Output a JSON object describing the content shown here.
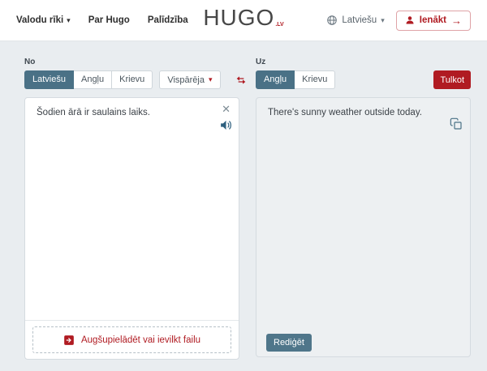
{
  "header": {
    "nav_items": [
      {
        "label": "Valodu rīki"
      },
      {
        "label": "Par Hugo"
      },
      {
        "label": "Palīdzība"
      }
    ],
    "logo": {
      "text": "HUGO",
      "suffix": ".LV"
    },
    "language_selector": {
      "label": "Latviešu"
    },
    "login_button": {
      "label": "Ienākt"
    }
  },
  "translator": {
    "source": {
      "label": "No",
      "language_tabs": [
        "Latviešu",
        "Angļu",
        "Krievu"
      ],
      "selected_language": "Latviešu",
      "domain_selector": "Vispārēja",
      "text": "Šodien ārā ir saulains laiks.",
      "upload_label": "Augšupielādēt vai ievilkt failu"
    },
    "target": {
      "label": "Uz",
      "language_tabs": [
        "Angļu",
        "Krievu"
      ],
      "selected_language": "Angļu",
      "translate_button": "Tulkot",
      "text": "There's sunny weather outside today.",
      "edit_button": "Rediģēt"
    }
  },
  "icons": {
    "nav_caret": "▾",
    "language_caret": "▾",
    "domain_caret": "▾",
    "login_arrow": "→",
    "close": "✕",
    "globe": "globe-icon",
    "person": "person-icon",
    "swap": "swap-languages-icon",
    "speaker": "text-to-speech-icon",
    "copy": "copy-icon",
    "upload": "upload-file-icon"
  },
  "colors": {
    "accent_red": "#b01b22",
    "slate_blue": "#4a7186",
    "page_background": "#e9edf0"
  }
}
